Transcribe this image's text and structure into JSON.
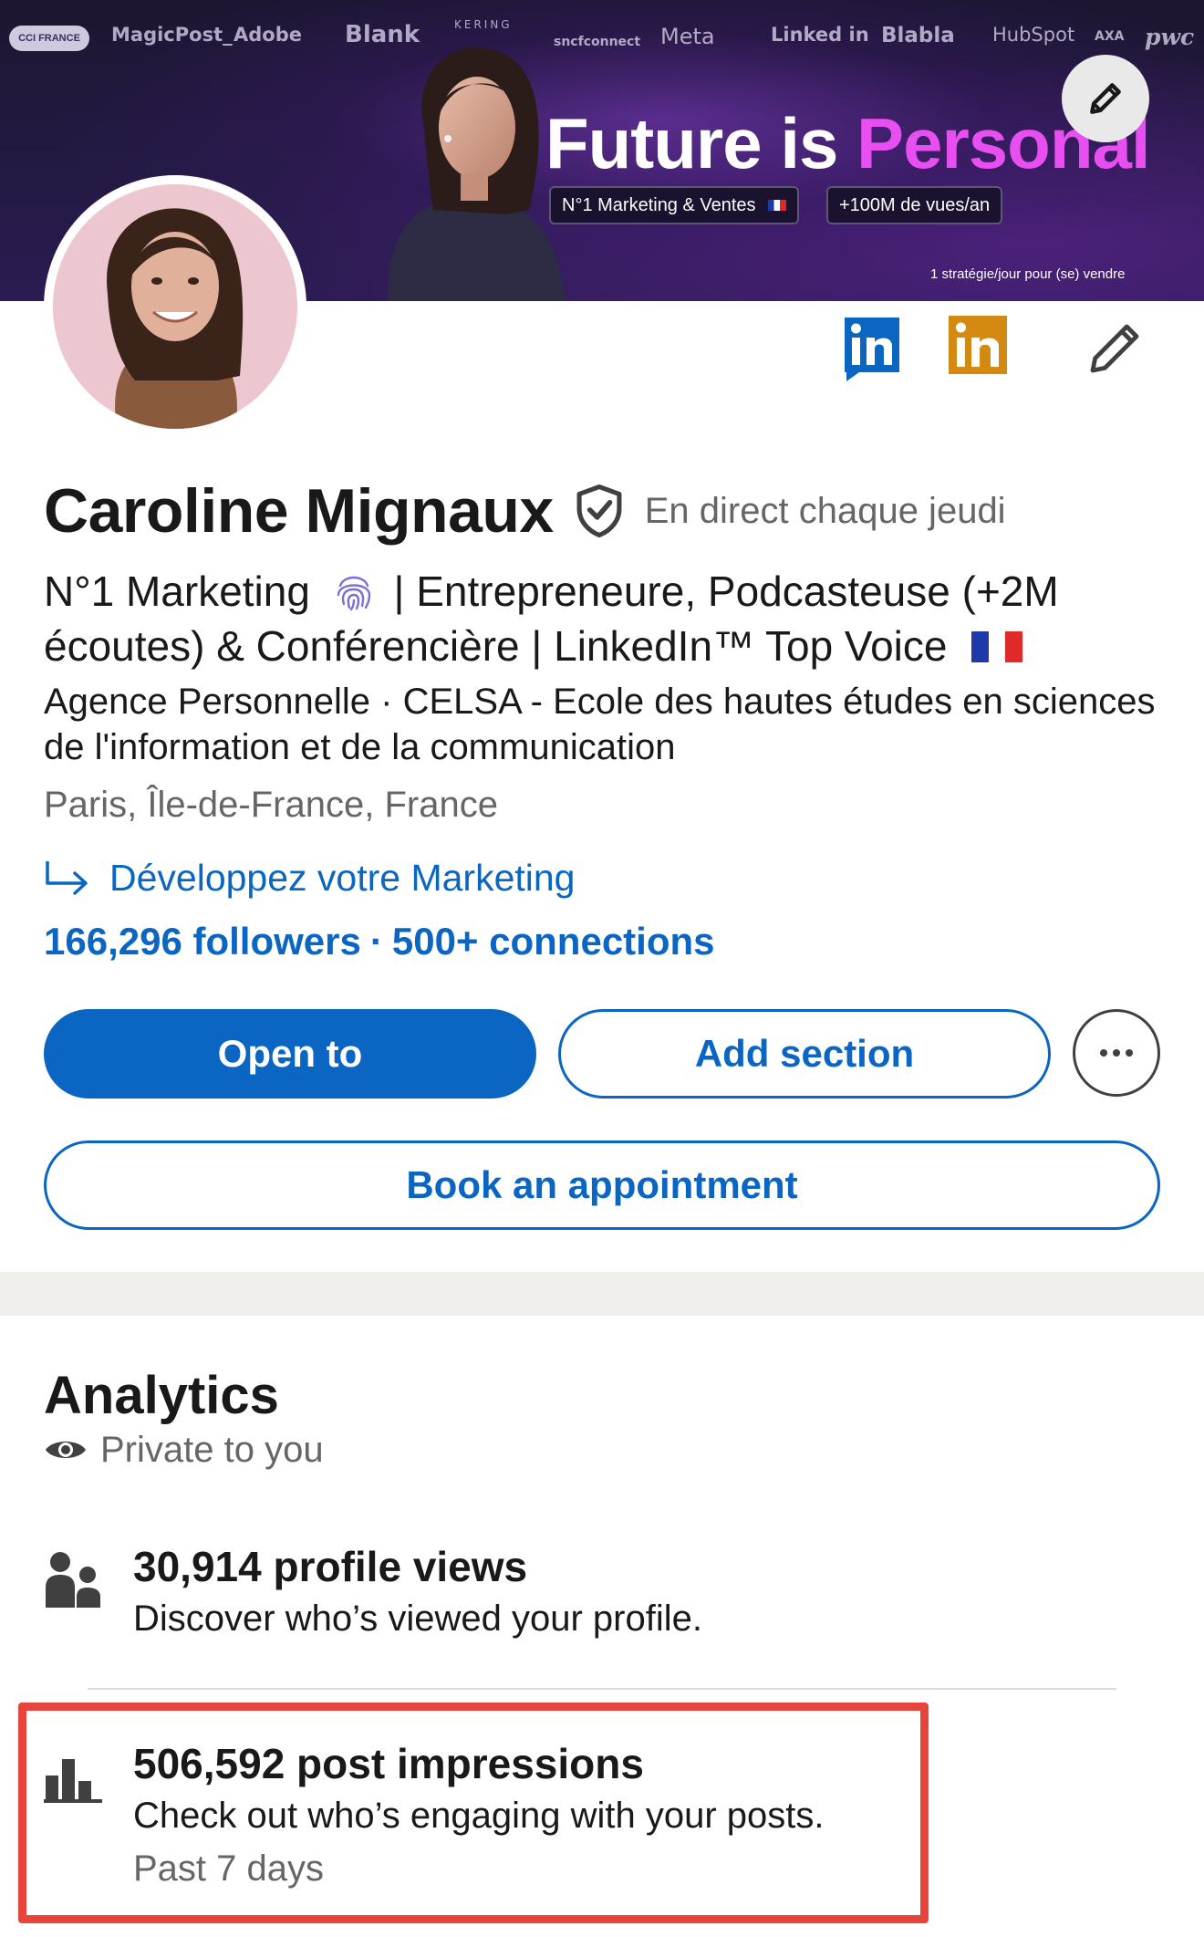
{
  "banner": {
    "logos": [
      "CCI FRANCE",
      "MagicPost_",
      "Adobe",
      "Blank",
      "KERING",
      "sncfconnect",
      "Meta",
      "Linked in",
      "Blabla",
      "HubSpot",
      "AXA",
      "pwc"
    ],
    "headline_main": "Future is ",
    "headline_accent": "Personal",
    "badge_1": "N°1 Marketing & Ventes",
    "badge_2": "+100M de vues/an",
    "tagline": "1 stratégie/jour pour (se) vendre",
    "accent_color": "#e84ff0"
  },
  "profile": {
    "name": "Caroline Mignaux",
    "verified_icon": "shield-check-icon",
    "pronoun_label": "En direct chaque jeudi",
    "headline_part1": "N°1 Marketing",
    "headline_part2": "| Entrepreneure, Podcasteuse (+2M écoutes) & Conférencière | LinkedIn™ Top Voice",
    "company": "Agence Personnelle · CELSA - Ecole des hautes études en sciences de l'information et de la communication",
    "location": "Paris, Île-de-France, France",
    "link_text": "Développez votre Marketing",
    "followers": "166,296 followers",
    "connections": "500+ connections"
  },
  "actions": {
    "open_to": "Open to",
    "add_section": "Add section",
    "book_appointment": "Book an appointment"
  },
  "analytics": {
    "title": "Analytics",
    "private_label": "Private to you",
    "profile_views": {
      "title": "30,914 profile views",
      "description": "Discover who’s viewed your profile."
    },
    "post_impressions": {
      "title": "506,592 post impressions",
      "description": "Check out who’s engaging with your posts.",
      "period": "Past 7 days"
    }
  },
  "colors": {
    "brand_blue": "#0a66c2",
    "linkedin_gold": "#d48a12",
    "highlight_red": "#e5453a"
  }
}
